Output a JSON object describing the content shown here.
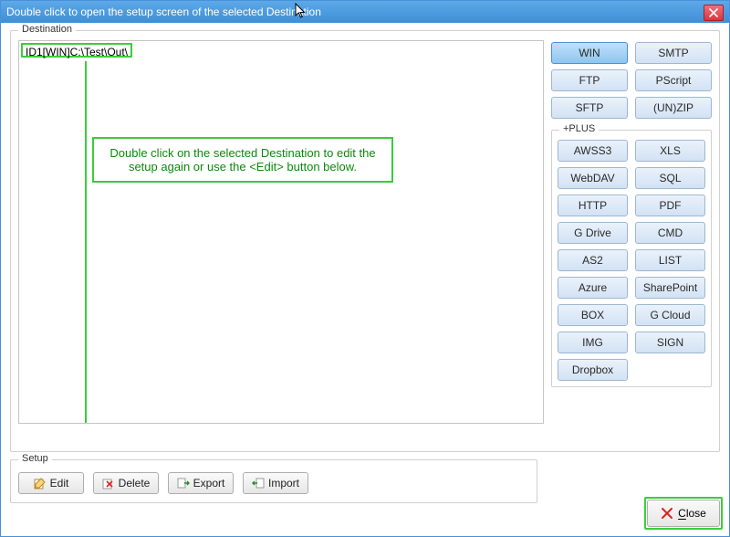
{
  "titlebar": {
    "text": "Double click to open the setup screen of the selected Destination"
  },
  "groups": {
    "destination": "Destination",
    "setup": "Setup",
    "plus": "+PLUS"
  },
  "list": {
    "items": [
      "ID1[WIN]C:\\Test\\Out\\"
    ]
  },
  "callout": {
    "text": "Double click on the selected Destination to edit the setup again or use the <Edit> button below."
  },
  "types": {
    "top": [
      [
        "WIN",
        "SMTP"
      ],
      [
        "FTP",
        "PScript"
      ],
      [
        "SFTP",
        "(UN)ZIP"
      ]
    ],
    "plus": [
      [
        "AWSS3",
        "XLS"
      ],
      [
        "WebDAV",
        "SQL"
      ],
      [
        "HTTP",
        "PDF"
      ],
      [
        "G Drive",
        "CMD"
      ],
      [
        "AS2",
        "LIST"
      ],
      [
        "Azure",
        "SharePoint"
      ],
      [
        "BOX",
        "G Cloud"
      ],
      [
        "IMG",
        "SIGN"
      ],
      [
        "Dropbox",
        ""
      ]
    ],
    "selected": "WIN"
  },
  "setup_buttons": {
    "edit": "Edit",
    "delete": "Delete",
    "export": "Export",
    "import": "Import"
  },
  "footer": {
    "close": "Close"
  }
}
